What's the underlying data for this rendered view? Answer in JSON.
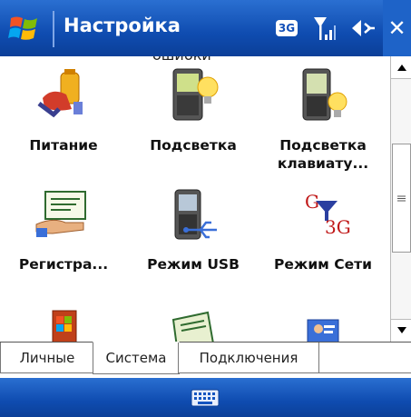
{
  "titlebar": {
    "title": "Настройка",
    "network_badge": "3G",
    "close_glyph": "✕",
    "colors": {
      "bar": "#1454c0",
      "text": "#ffffff"
    }
  },
  "content": {
    "cut_off_text": "ошибки",
    "items": [
      {
        "label": "Питание",
        "icon": "battery-power-icon"
      },
      {
        "label": "Подсветка",
        "icon": "backlight-phone-icon"
      },
      {
        "label": "Подсветка\nклавиату...",
        "icon": "keyboard-backlight-icon"
      },
      {
        "label": "Регистра...",
        "icon": "registration-certificate-icon"
      },
      {
        "label": "Режим USB",
        "icon": "usb-mode-icon"
      },
      {
        "label": "Режим Сети",
        "icon": "network-mode-icon",
        "icon_text_top": "G",
        "icon_text_bottom": "3G"
      },
      {
        "label": "",
        "icon": "windows-app-icon"
      },
      {
        "label": "",
        "icon": "document-settings-icon"
      },
      {
        "label": "",
        "icon": "customer-feedback-icon"
      }
    ]
  },
  "tabs": [
    {
      "label": "Личные",
      "active": false
    },
    {
      "label": "Система",
      "active": true
    },
    {
      "label": "Подключения",
      "active": false
    }
  ],
  "bottombar": {
    "icon": "keyboard-icon"
  }
}
